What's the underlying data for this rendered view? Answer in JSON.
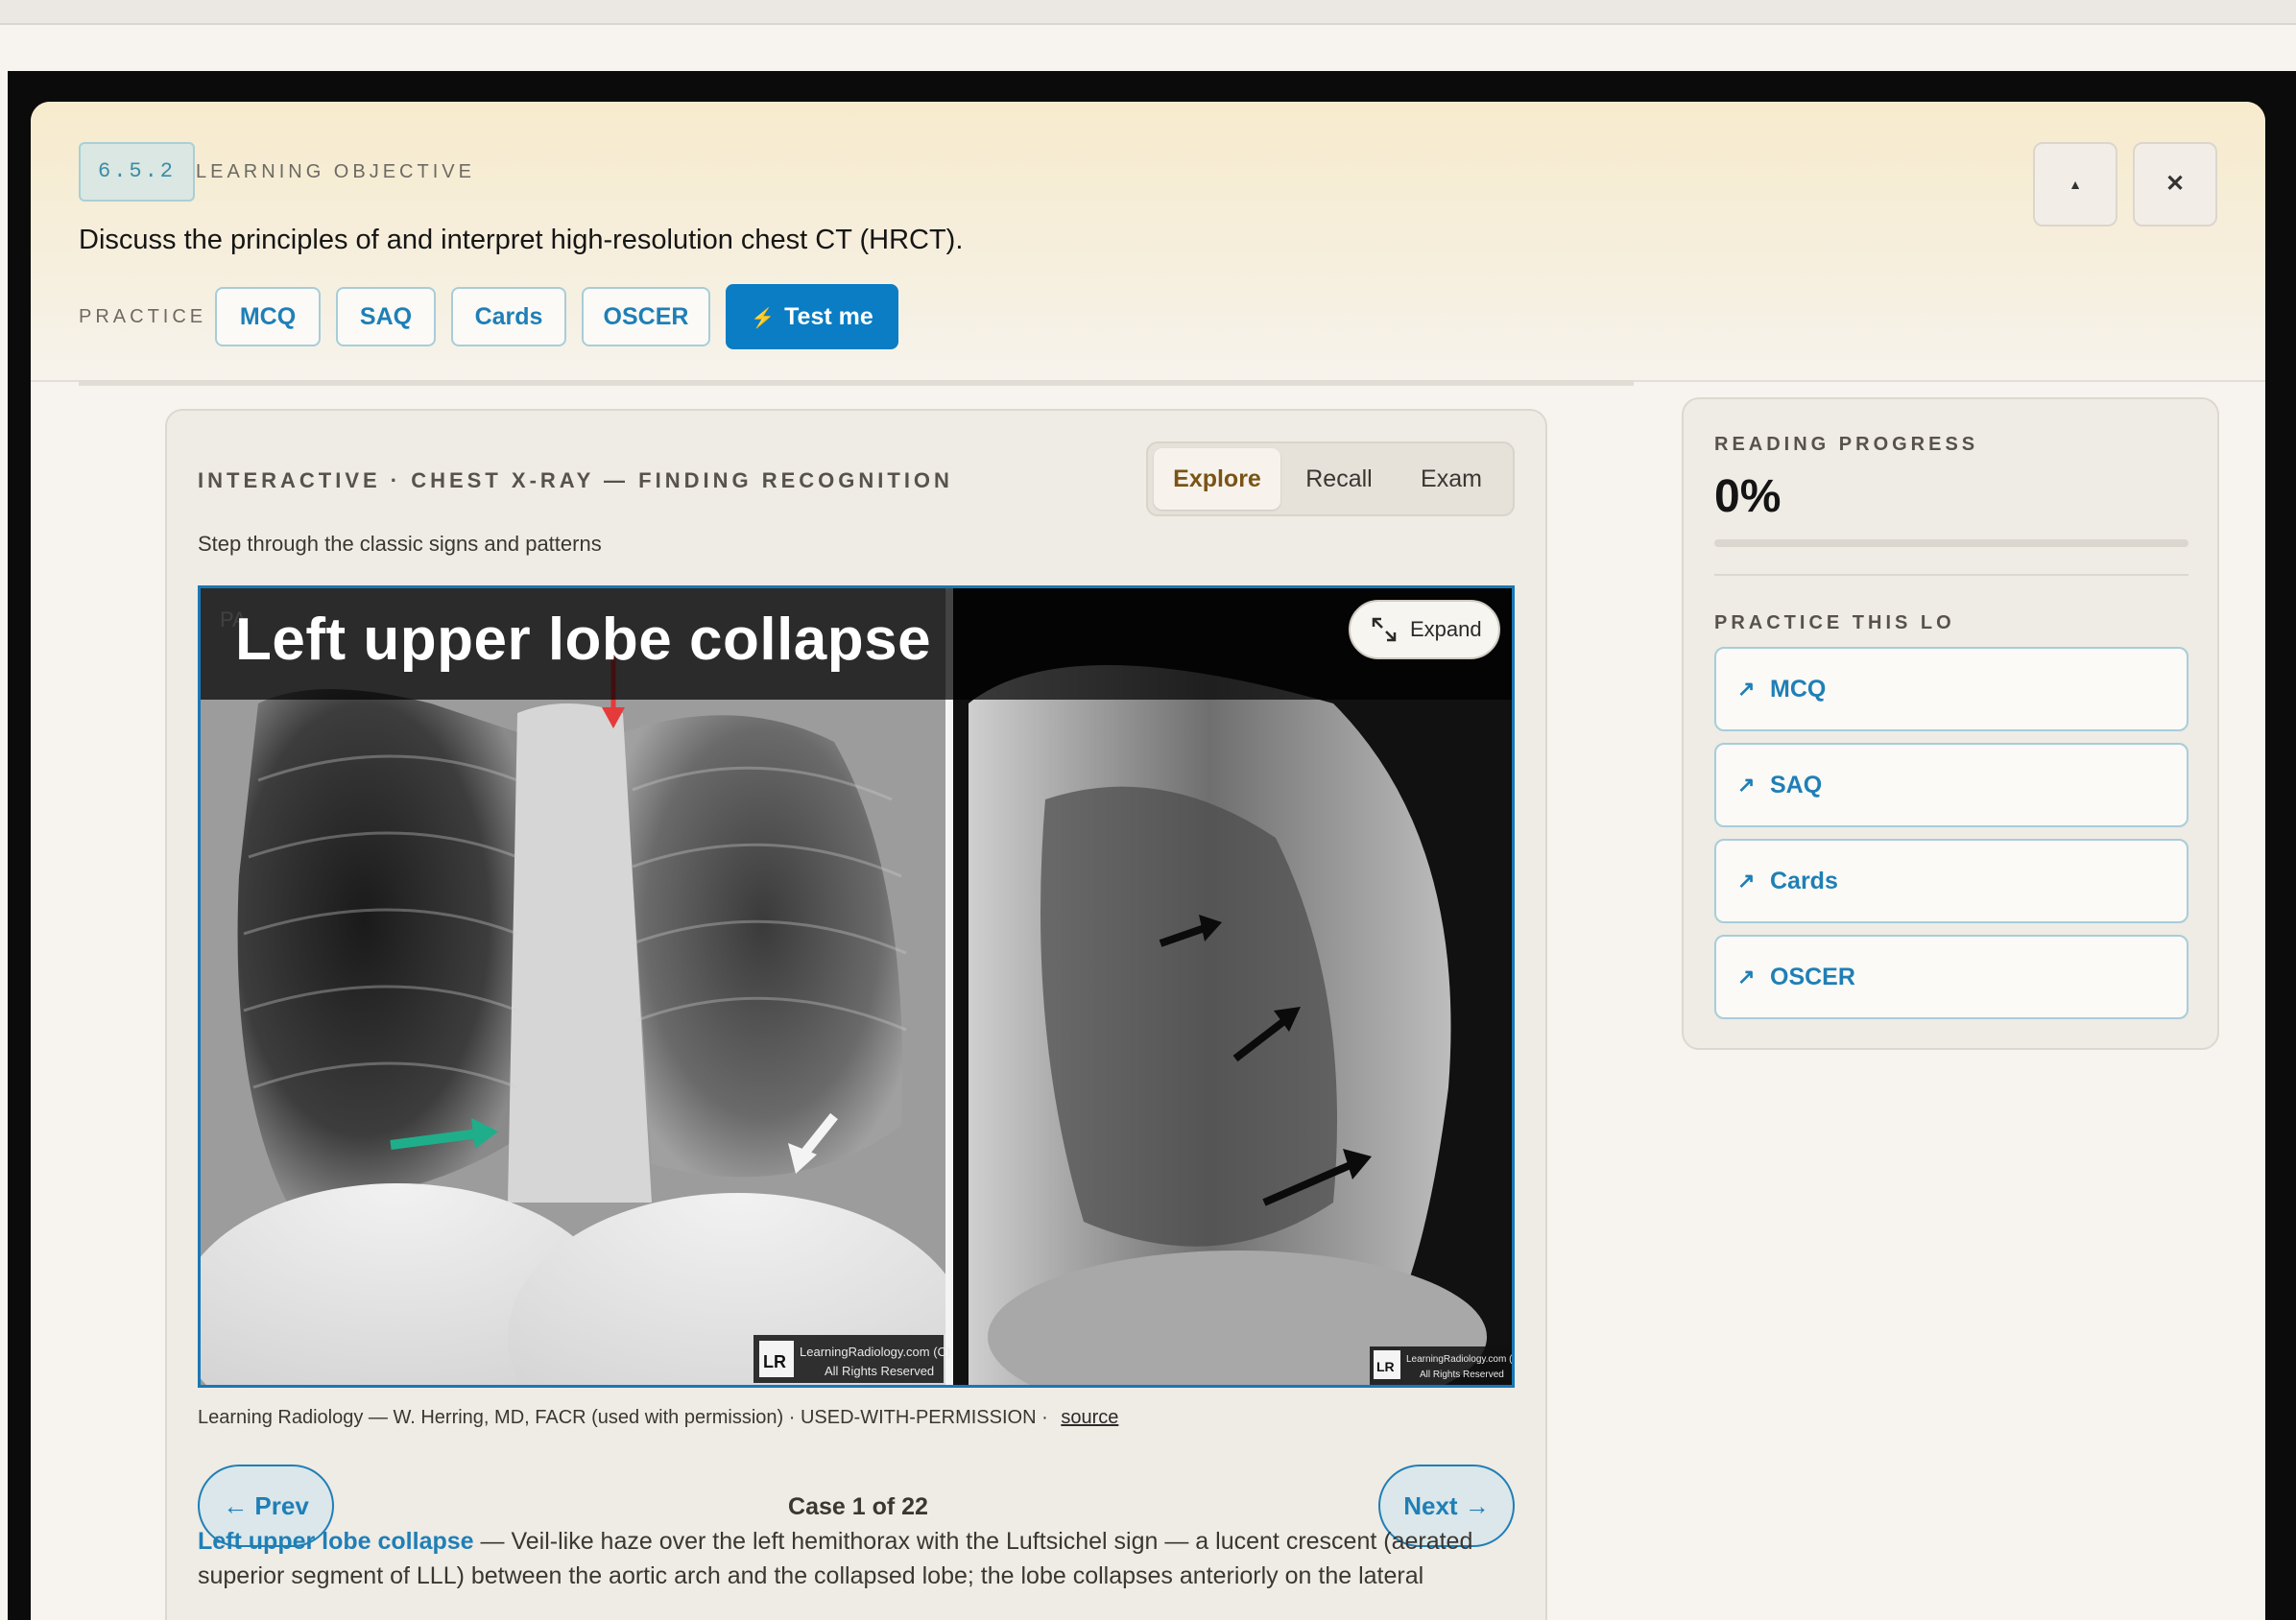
{
  "header": {
    "lo_code": "6.5.2",
    "lo_label": "LEARNING OBJECTIVE",
    "lo_title": "Discuss the principles of and interpret high-resolution chest CT (HRCT).",
    "practice_label": "PRACTICE",
    "practice_buttons": [
      "MCQ",
      "SAQ",
      "Cards",
      "OSCER"
    ],
    "test_me_label": "Test me",
    "collapse_glyph": "▲",
    "close_glyph": "✕"
  },
  "card": {
    "eyebrow": "INTERACTIVE · CHEST X-RAY — FINDING RECOGNITION",
    "subtitle": "Step through the classic signs and patterns",
    "modes": [
      "Explore",
      "Recall",
      "Exam"
    ],
    "active_mode": "Explore",
    "case_title": "Left upper lobe collapse",
    "expand_label": "Expand",
    "attribution": "Learning Radiology — W. Herring, MD, FACR (used with permission) · USED-WITH-PERMISSION · ",
    "source_label": "source",
    "prev_label": "← Prev",
    "next_label": "Next →",
    "case_counter": "Case 1 of 22",
    "description_link": "Left upper lobe collapse",
    "description_text": " — Veil-like haze over the left hemithorax with the Luftsichel sign — a lucent crescent (aerated superior segment of LLL) between the aortic arch and the collapsed lobe; the lobe collapses anteriorly on the lateral",
    "image_markings": {
      "pa_label": "PA",
      "watermark_line1": "LearningRadiology.com (C)",
      "watermark_line2": "All Rights Reserved",
      "logo_text": "LR"
    },
    "arrow_colors": {
      "red": "#e43a3a",
      "green": "#1fae8a",
      "white": "#f4f4f4",
      "black": "#0b0b0b"
    }
  },
  "sidebar": {
    "progress_label": "READING PROGRESS",
    "progress_value": "0%",
    "progress_fraction": 0,
    "practice_label": "PRACTICE THIS LO",
    "links": [
      "MCQ",
      "SAQ",
      "Cards",
      "OSCER"
    ],
    "link_icon": "arrow-up-right-icon"
  },
  "colors": {
    "accent": "#0a7dc4",
    "link": "#1f7fb6",
    "active_mode": "#7a5416",
    "background": "#f7f4ef"
  }
}
